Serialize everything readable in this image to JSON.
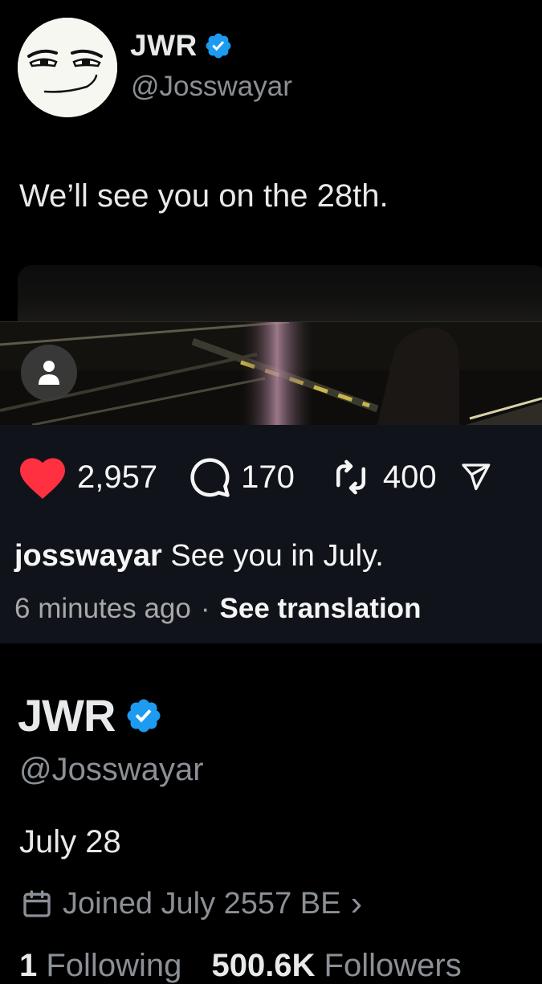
{
  "tweet": {
    "display_name": "JWR",
    "handle": "@Josswayar",
    "text": "We’ll see you on the 28th.",
    "avatar_icon": "meme-face-icon",
    "verified_icon": "verified-badge-icon"
  },
  "instagram": {
    "likes": "2,957",
    "comments": "170",
    "reposts": "400",
    "caption_user": "josswayar",
    "caption_text": " See you in July.",
    "time_ago": "6 minutes ago",
    "separator": "·",
    "see_translation": "See translation",
    "icons": [
      "heart-icon",
      "comment-icon",
      "repost-icon",
      "share-icon",
      "user-tag-icon"
    ]
  },
  "profile": {
    "display_name": "JWR",
    "handle": "@Josswayar",
    "bio": "July 28",
    "joined": "Joined July 2557 BE",
    "chevron": "›",
    "following_count": "1",
    "following_label": " Following",
    "followers_count": "500.6K",
    "followers_label": " Followers"
  },
  "colors": {
    "background": "#000000",
    "verified": "#1d9bf0",
    "like": "#ff3040",
    "secondary_text": "#8b9096"
  }
}
